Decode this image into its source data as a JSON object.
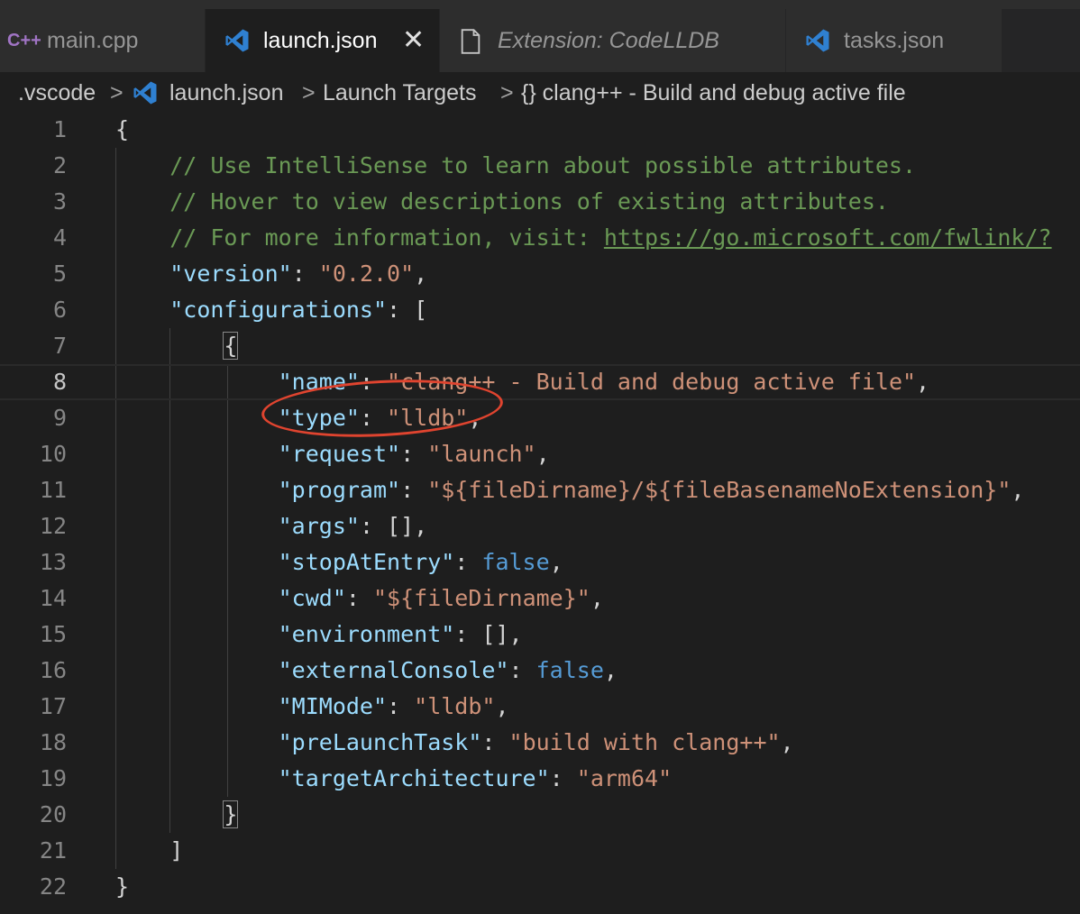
{
  "tabs": [
    {
      "label": "main.cpp",
      "icon": "cpp-icon",
      "icon_text": "C++",
      "active": false
    },
    {
      "label": "launch.json",
      "icon": "vscode-icon",
      "active": true,
      "closable": true
    },
    {
      "label": "Extension: CodeLLDB",
      "icon": "file-icon",
      "active": false,
      "italic": true
    },
    {
      "label": "tasks.json",
      "icon": "vscode-icon",
      "active": false
    }
  ],
  "close_glyph": "✕",
  "breadcrumb": {
    "items": [
      ".vscode",
      "launch.json",
      "Launch Targets",
      "{} clang++ - Build and debug active file"
    ],
    "separator": ">"
  },
  "editor": {
    "current_line": 8,
    "lines": [
      {
        "n": "1",
        "tokens": [
          {
            "t": "{",
            "c": "p"
          }
        ]
      },
      {
        "n": "2",
        "tokens": [
          {
            "t": "    ",
            "c": "p"
          },
          {
            "t": "// Use IntelliSense to learn about possible attributes.",
            "c": "c"
          }
        ]
      },
      {
        "n": "3",
        "tokens": [
          {
            "t": "    ",
            "c": "p"
          },
          {
            "t": "// Hover to view descriptions of existing attributes.",
            "c": "c"
          }
        ]
      },
      {
        "n": "4",
        "tokens": [
          {
            "t": "    ",
            "c": "p"
          },
          {
            "t": "// For more information, visit: ",
            "c": "c"
          },
          {
            "t": "https://go.microsoft.com/fwlink/?",
            "c": "u"
          }
        ]
      },
      {
        "n": "5",
        "tokens": [
          {
            "t": "    ",
            "c": "p"
          },
          {
            "t": "\"version\"",
            "c": "k"
          },
          {
            "t": ": ",
            "c": "p"
          },
          {
            "t": "\"0.2.0\"",
            "c": "s"
          },
          {
            "t": ",",
            "c": "p"
          }
        ]
      },
      {
        "n": "6",
        "tokens": [
          {
            "t": "    ",
            "c": "p"
          },
          {
            "t": "\"configurations\"",
            "c": "k"
          },
          {
            "t": ": [",
            "c": "p"
          }
        ]
      },
      {
        "n": "7",
        "tokens": [
          {
            "t": "        ",
            "c": "p"
          },
          {
            "t": "{",
            "c": "bm"
          }
        ]
      },
      {
        "n": "8",
        "tokens": [
          {
            "t": "            ",
            "c": "p"
          },
          {
            "t": "\"name\"",
            "c": "k"
          },
          {
            "t": ": ",
            "c": "p"
          },
          {
            "t": "\"clang++ - Build and debug active file\"",
            "c": "s"
          },
          {
            "t": ",",
            "c": "p"
          }
        ]
      },
      {
        "n": "9",
        "tokens": [
          {
            "t": "            ",
            "c": "p"
          },
          {
            "t": "\"type\"",
            "c": "k"
          },
          {
            "t": ": ",
            "c": "p"
          },
          {
            "t": "\"lldb\"",
            "c": "s"
          },
          {
            "t": ",",
            "c": "p"
          }
        ]
      },
      {
        "n": "10",
        "tokens": [
          {
            "t": "            ",
            "c": "p"
          },
          {
            "t": "\"request\"",
            "c": "k"
          },
          {
            "t": ": ",
            "c": "p"
          },
          {
            "t": "\"launch\"",
            "c": "s"
          },
          {
            "t": ",",
            "c": "p"
          }
        ]
      },
      {
        "n": "11",
        "tokens": [
          {
            "t": "            ",
            "c": "p"
          },
          {
            "t": "\"program\"",
            "c": "k"
          },
          {
            "t": ": ",
            "c": "p"
          },
          {
            "t": "\"${fileDirname}/${fileBasenameNoExtension}\"",
            "c": "s"
          },
          {
            "t": ",",
            "c": "p"
          }
        ]
      },
      {
        "n": "12",
        "tokens": [
          {
            "t": "            ",
            "c": "p"
          },
          {
            "t": "\"args\"",
            "c": "k"
          },
          {
            "t": ": [],",
            "c": "p"
          }
        ]
      },
      {
        "n": "13",
        "tokens": [
          {
            "t": "            ",
            "c": "p"
          },
          {
            "t": "\"stopAtEntry\"",
            "c": "k"
          },
          {
            "t": ": ",
            "c": "p"
          },
          {
            "t": "false",
            "c": "b"
          },
          {
            "t": ",",
            "c": "p"
          }
        ]
      },
      {
        "n": "14",
        "tokens": [
          {
            "t": "            ",
            "c": "p"
          },
          {
            "t": "\"cwd\"",
            "c": "k"
          },
          {
            "t": ": ",
            "c": "p"
          },
          {
            "t": "\"${fileDirname}\"",
            "c": "s"
          },
          {
            "t": ",",
            "c": "p"
          }
        ]
      },
      {
        "n": "15",
        "tokens": [
          {
            "t": "            ",
            "c": "p"
          },
          {
            "t": "\"environment\"",
            "c": "k"
          },
          {
            "t": ": [],",
            "c": "p"
          }
        ]
      },
      {
        "n": "16",
        "tokens": [
          {
            "t": "            ",
            "c": "p"
          },
          {
            "t": "\"externalConsole\"",
            "c": "k"
          },
          {
            "t": ": ",
            "c": "p"
          },
          {
            "t": "false",
            "c": "b"
          },
          {
            "t": ",",
            "c": "p"
          }
        ]
      },
      {
        "n": "17",
        "tokens": [
          {
            "t": "            ",
            "c": "p"
          },
          {
            "t": "\"MIMode\"",
            "c": "k"
          },
          {
            "t": ": ",
            "c": "p"
          },
          {
            "t": "\"lldb\"",
            "c": "s"
          },
          {
            "t": ",",
            "c": "p"
          }
        ]
      },
      {
        "n": "18",
        "tokens": [
          {
            "t": "            ",
            "c": "p"
          },
          {
            "t": "\"preLaunchTask\"",
            "c": "k"
          },
          {
            "t": ": ",
            "c": "p"
          },
          {
            "t": "\"build with clang++\"",
            "c": "s"
          },
          {
            "t": ",",
            "c": "p"
          }
        ]
      },
      {
        "n": "19",
        "tokens": [
          {
            "t": "            ",
            "c": "p"
          },
          {
            "t": "\"targetArchitecture\"",
            "c": "k"
          },
          {
            "t": ": ",
            "c": "p"
          },
          {
            "t": "\"arm64\"",
            "c": "s"
          }
        ]
      },
      {
        "n": "20",
        "tokens": [
          {
            "t": "        ",
            "c": "p"
          },
          {
            "t": "}",
            "c": "bm"
          }
        ]
      },
      {
        "n": "21",
        "tokens": [
          {
            "t": "    ]",
            "c": "p"
          }
        ]
      },
      {
        "n": "22",
        "tokens": [
          {
            "t": "}",
            "c": "p"
          }
        ]
      }
    ]
  },
  "annotation": {
    "highlighted_line": 9,
    "color": "#e0442f"
  },
  "colors": {
    "editor_bg": "#1e1e1e",
    "key": "#9cdcfe",
    "string": "#ce9178",
    "boolean": "#569cd6",
    "comment": "#6a9955",
    "vscode_blue": "#2f80d1"
  }
}
